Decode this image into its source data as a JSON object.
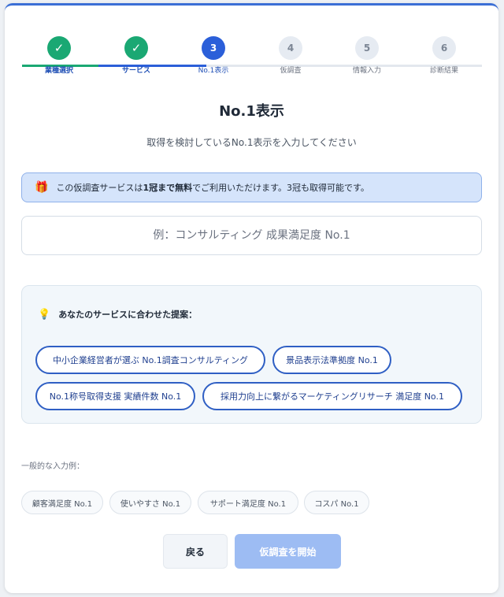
{
  "steps": [
    {
      "num": "✓",
      "label": "業種選択",
      "state": "done"
    },
    {
      "num": "✓",
      "label": "サービス",
      "state": "done"
    },
    {
      "num": "3",
      "label": "No.1表示",
      "state": "active"
    },
    {
      "num": "4",
      "label": "仮調査",
      "state": "todo"
    },
    {
      "num": "5",
      "label": "情報入力",
      "state": "todo"
    },
    {
      "num": "6",
      "label": "診断結果",
      "state": "todo"
    }
  ],
  "page": {
    "title": "No.1表示",
    "subtitle": "取得を検討しているNo.1表示を入力してください"
  },
  "notice": {
    "prefix": "この仮調査サービスは",
    "bold1": "1冠まで",
    "bold2": "無料",
    "suffix": "でご利用いただけます。3冠も取得可能です。"
  },
  "input": {
    "placeholder": "例：コンサルティング 成果満足度 No.1",
    "value": ""
  },
  "suggestions": {
    "heading": "あなたのサービスに合わせた提案：",
    "items": [
      "中小企業経営者が選ぶ No.1調査コンサルティング",
      "景品表示法準拠度 No.1",
      "No.1称号取得支援 実績件数 No.1",
      "採用力向上に繋がるマーケティングリサーチ 満足度 No.1"
    ]
  },
  "examples": {
    "label": "一般的な入力例：",
    "items": [
      "顧客満足度 No.1",
      "使いやすさ No.1",
      "サポート満足度 No.1",
      "コスパ No.1"
    ]
  },
  "buttons": {
    "back": "戻る",
    "start": "仮調査を開始"
  },
  "colors": {
    "done": "#1aa873",
    "active": "#2b5fd9",
    "todo": "#e6ebf2",
    "accent": "#2f5fc4"
  }
}
